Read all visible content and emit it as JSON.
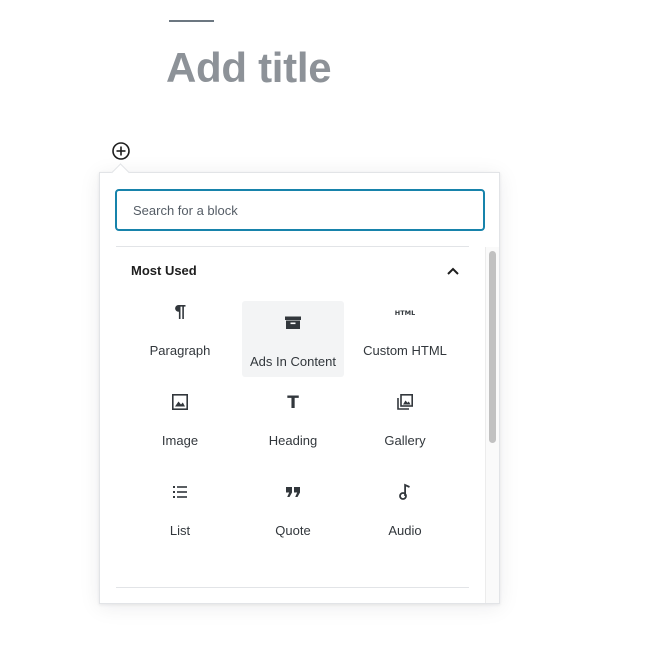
{
  "editor": {
    "title_placeholder": "Add title"
  },
  "inserter": {
    "toggle_icon": "plus-circle-icon",
    "search": {
      "placeholder": "Search for a block",
      "value": ""
    },
    "panel": {
      "title": "Most Used",
      "expanded": true,
      "chevron_icon": "chevron-up-icon"
    },
    "blocks": [
      {
        "label": "Paragraph",
        "icon": "paragraph-icon"
      },
      {
        "label": "Ads In Content",
        "icon": "archive-icon"
      },
      {
        "label": "Custom HTML",
        "icon": "html-icon",
        "icon_text": "HTML"
      },
      {
        "label": "Image",
        "icon": "image-icon"
      },
      {
        "label": "Heading",
        "icon": "heading-icon",
        "icon_text": "T"
      },
      {
        "label": "Gallery",
        "icon": "gallery-icon"
      },
      {
        "label": "List",
        "icon": "list-icon"
      },
      {
        "label": "Quote",
        "icon": "quote-icon"
      },
      {
        "label": "Audio",
        "icon": "audio-icon"
      }
    ]
  },
  "colors": {
    "search_focus_border": "#1783ab",
    "title_text": "#8d9298",
    "hover_background": "#f3f4f5"
  }
}
